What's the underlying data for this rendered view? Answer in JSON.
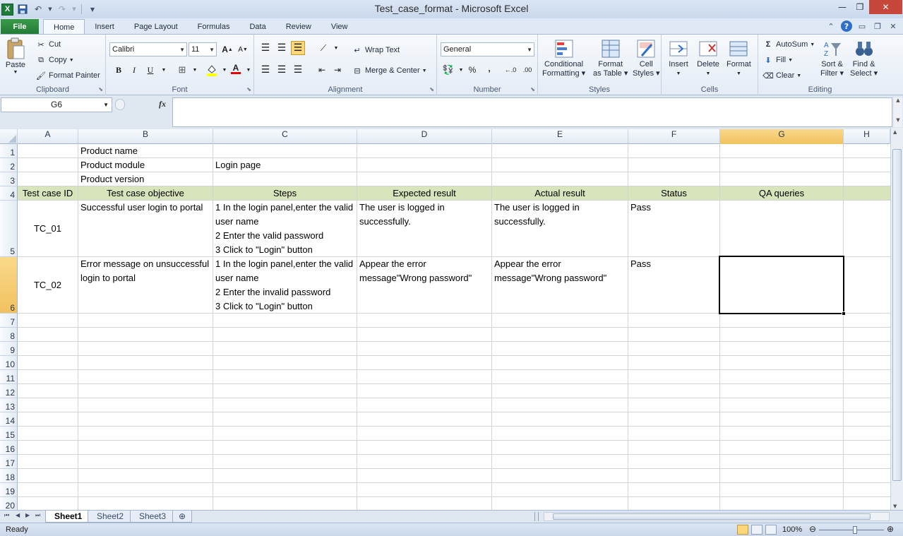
{
  "window": {
    "title": "Test_case_format  -  Microsoft Excel",
    "minimize": "—",
    "restore": "❐",
    "close": "✕"
  },
  "tabs": {
    "file": "File",
    "items": [
      "Home",
      "Insert",
      "Page Layout",
      "Formulas",
      "Data",
      "Review",
      "View"
    ],
    "active": "Home"
  },
  "ribbon": {
    "clipboard": {
      "label": "Clipboard",
      "paste": "Paste",
      "cut": "Cut",
      "copy": "Copy",
      "format_painter": "Format Painter"
    },
    "font": {
      "label": "Font",
      "family": "Calibri",
      "size": "11",
      "bold": "B",
      "italic": "I",
      "underline": "U"
    },
    "alignment": {
      "label": "Alignment",
      "wrap_text": "Wrap Text",
      "merge_center": "Merge & Center"
    },
    "number": {
      "label": "Number",
      "format": "General",
      "percent": "%",
      "comma": ","
    },
    "styles": {
      "label": "Styles",
      "conditional": "Conditional",
      "formatting": "Formatting",
      "format_as": "Format",
      "as_table": "as Table",
      "cell": "Cell",
      "styles": "Styles"
    },
    "cells": {
      "label": "Cells",
      "insert": "Insert",
      "delete": "Delete",
      "format": "Format"
    },
    "editing": {
      "label": "Editing",
      "autosum": "AutoSum",
      "fill": "Fill",
      "clear": "Clear",
      "sort": "Sort &",
      "filter": "Filter",
      "find": "Find &",
      "select": "Select"
    }
  },
  "formula_bar": {
    "name_box": "G6",
    "fx": "fx",
    "content": ""
  },
  "columns": [
    "A",
    "B",
    "C",
    "D",
    "E",
    "F",
    "G",
    "H"
  ],
  "selected_cell": "G6",
  "rows": [
    "1",
    "2",
    "3",
    "4",
    "5",
    "6",
    "7",
    "8",
    "9",
    "10",
    "11",
    "12",
    "13",
    "14",
    "15",
    "16",
    "17",
    "18",
    "19",
    "20"
  ],
  "cells": {
    "B1": "Product name",
    "B2": "Product module",
    "C2": "Login page",
    "B3": "Product version",
    "A4": "Test case ID",
    "B4": "Test case objective",
    "C4": "Steps",
    "D4": "Expected result",
    "E4": "Actual result",
    "F4": "Status",
    "G4": "QA queries",
    "A5": "TC_01",
    "B5": "Successful user login to portal",
    "C5": "1 In the login panel,enter the valid user name\n2 Enter the valid password\n3 Click to \"Login\" button",
    "D5": "The user is logged in successfully.",
    "E5": "The user is logged in successfully.",
    "F5": "Pass",
    "A6": "TC_02",
    "B6": "Error message on unsuccessful  login to portal",
    "C6": "1 In the login panel,enter the valid user name\n2 Enter the invalid password\n3 Click to \"Login\" button",
    "D6": "Appear the error message\"Wrong password\"",
    "E6": "Appear the error message\"Wrong password\"",
    "F6": "Pass"
  },
  "header_band_color": "#d8e4bc",
  "sheets": [
    "Sheet1",
    "Sheet2",
    "Sheet3"
  ],
  "active_sheet": "Sheet1",
  "status": {
    "ready": "Ready",
    "zoom": "100%"
  }
}
